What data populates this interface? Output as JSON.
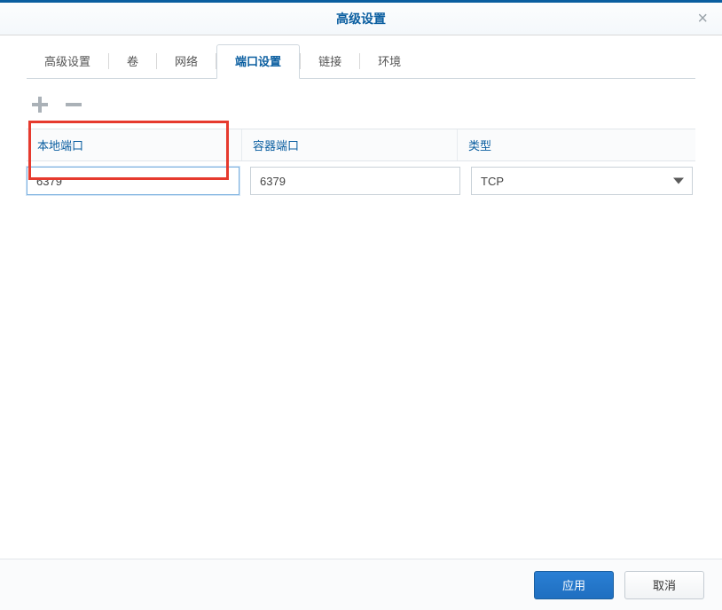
{
  "dialog": {
    "title": "高级设置"
  },
  "tabs": [
    {
      "label": "高级设置",
      "active": false
    },
    {
      "label": "卷",
      "active": false
    },
    {
      "label": "网络",
      "active": false
    },
    {
      "label": "端口设置",
      "active": true
    },
    {
      "label": "链接",
      "active": false
    },
    {
      "label": "环境",
      "active": false
    }
  ],
  "toolbar": {
    "add_icon": "plus-icon",
    "remove_icon": "minus-icon"
  },
  "table": {
    "headers": {
      "local_port": "本地端口",
      "container_port": "容器端口",
      "type": "类型"
    },
    "rows": [
      {
        "local_port": "6379",
        "container_port": "6379",
        "type": "TCP"
      }
    ]
  },
  "footer": {
    "apply_label": "应用",
    "cancel_label": "取消"
  }
}
